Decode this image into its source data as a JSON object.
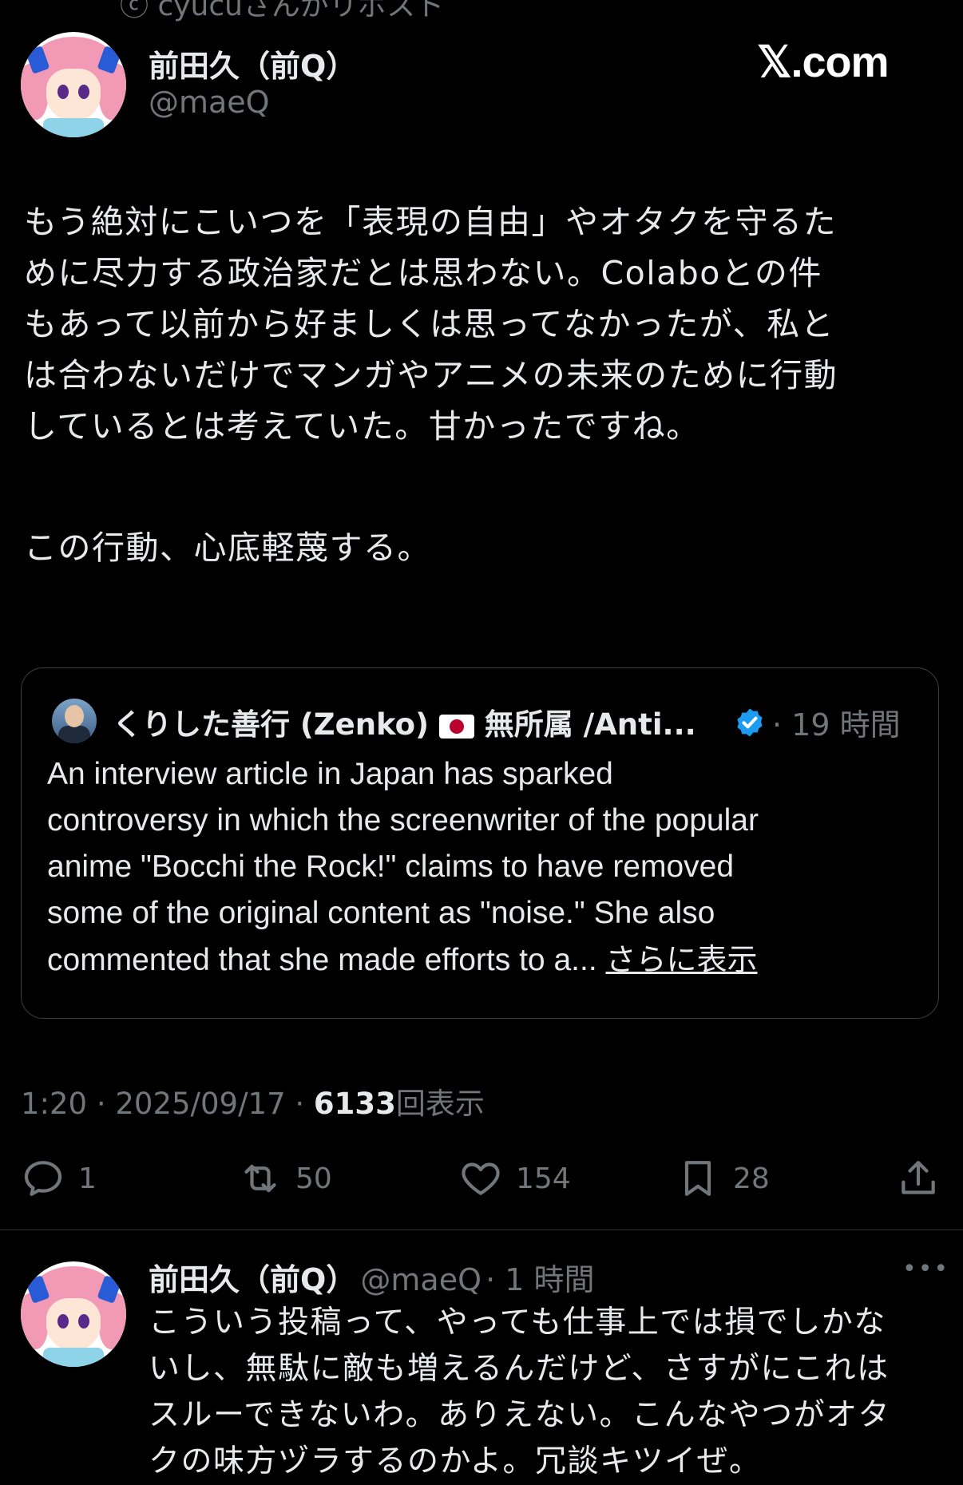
{
  "top_cut_text": "ⓒ cyucuさんがリポスト",
  "tweet": {
    "author_name": "前田久（前Q）",
    "handle": "@maeQ",
    "brand": "𝕏.com",
    "body_lines": [
      "もう絶対にこいつを「表現の自由」やオタクを守るた",
      "めに尽力する政治家だとは思わない。Colaboとの件",
      "もあって以前から好ましくは思ってなかったが、私と",
      "は合わないだけでマンガやアニメの未来のために行動",
      "しているとは考えていた。甘かったですね。",
      "",
      "この行動、心底軽蔑する。"
    ],
    "timestamp": "1:20 · 2025/09/17 · ",
    "views_count": "6133",
    "views_label": "回表示"
  },
  "quote": {
    "author_name": "くりした善行 (Zenko)",
    "author_suffix": "無所属 /Anti...",
    "time": "· 19 時間",
    "lines": [
      "An interview article in Japan has sparked",
      "controversy in which the screenwriter of the popular",
      "anime \"Bocchi the Rock!\" claims to have removed",
      "some of the original content as \"noise.\" She also",
      "commented that she made efforts to a... "
    ],
    "show_more": "さらに表示"
  },
  "actions": {
    "replies": "1",
    "reposts": "50",
    "likes": "154",
    "bookmarks": "28"
  },
  "reply": {
    "author_name": "前田久（前Q）",
    "handle": "@maeQ",
    "time": "· 1 時間",
    "more": "•••",
    "lines": [
      "こういう投稿って、やっても仕事上では損でしかな",
      "いし、無駄に敵も増えるんだけど、さすがにこれは",
      "スルーできないわ。ありえない。こんなやつがオタ",
      "クの味方ヅラするのかよ。冗談キツイぜ。"
    ]
  },
  "colors": {
    "background": "#000000",
    "text": "#e7e9ea",
    "muted": "#71767b",
    "verified": "#1d9bf0",
    "avatar_hair": "#f29ab5"
  }
}
